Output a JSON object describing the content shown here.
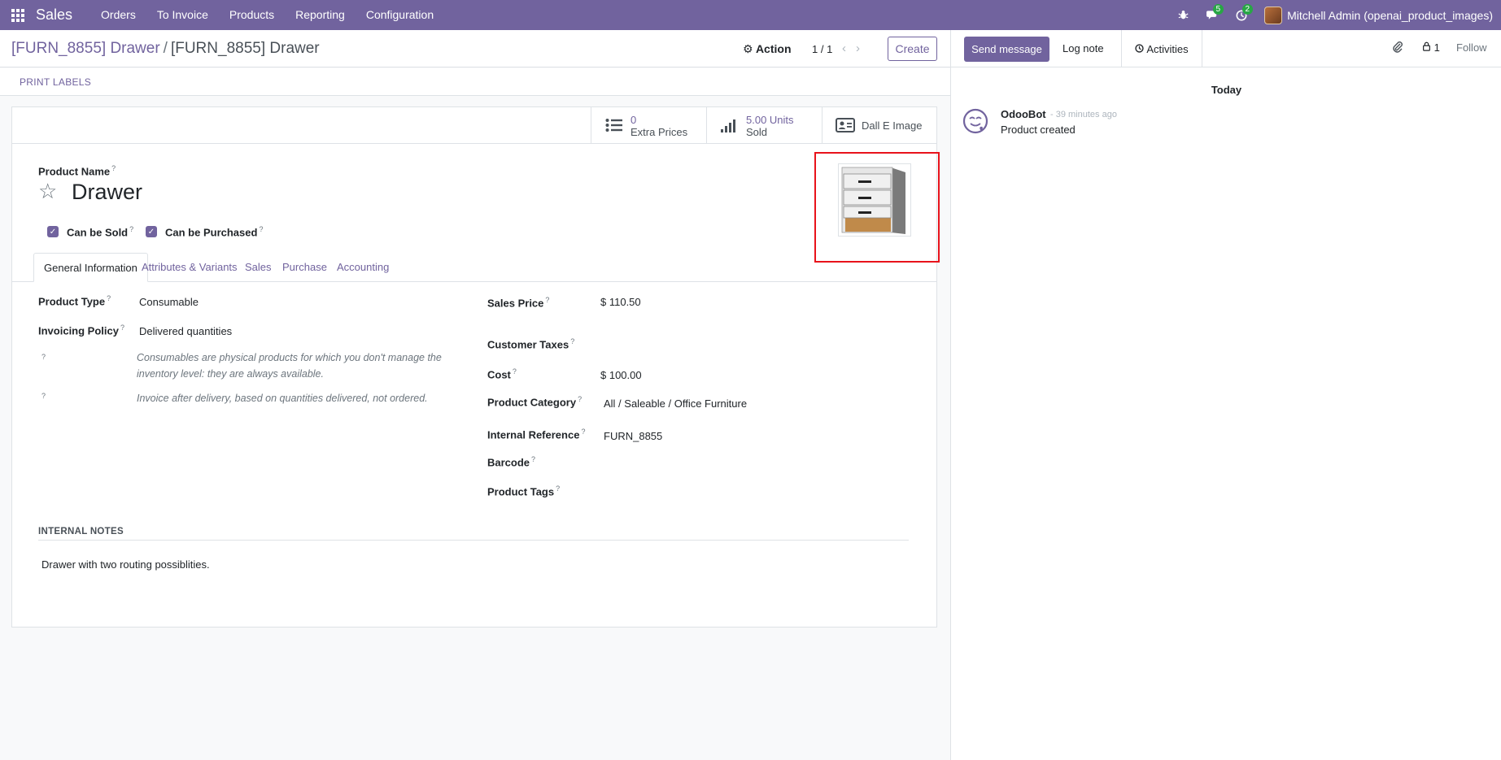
{
  "navbar": {
    "brand": "Sales",
    "menu": [
      "Orders",
      "To Invoice",
      "Products",
      "Reporting",
      "Configuration"
    ],
    "messages_count": "5",
    "activities_count": "2",
    "user": "Mitchell Admin (openai_product_images)"
  },
  "control": {
    "breadcrumb_parent": "[FURN_8855] Drawer",
    "breadcrumb_current": "[FURN_8855] Drawer",
    "action_label": "Action",
    "pager": "1 / 1",
    "create_label": "Create"
  },
  "statusbar": {
    "print_labels": "PRINT LABELS"
  },
  "smart_buttons": {
    "extra_prices_value": "0",
    "extra_prices_label": "Extra Prices",
    "sold_value": "5.00 Units",
    "sold_label": "Sold",
    "dalle_label": "Dall E Image"
  },
  "form": {
    "product_name_label": "Product Name",
    "product_name": "Drawer",
    "can_be_sold": "Can be Sold",
    "can_be_purchased": "Can be Purchased",
    "tabs": [
      "General Information",
      "Attributes & Variants",
      "Sales",
      "Purchase",
      "Accounting"
    ],
    "product_type_label": "Product Type",
    "product_type": "Consumable",
    "invoicing_policy_label": "Invoicing Policy",
    "invoicing_policy": "Delivered quantities",
    "help_consumable": "Consumables are physical products for which you don't manage the inventory level: they are always available.",
    "help_invoice": "Invoice after delivery, based on quantities delivered, not ordered.",
    "sales_price_label": "Sales Price",
    "sales_price": "$ 110.50",
    "customer_taxes_label": "Customer Taxes",
    "cost_label": "Cost",
    "cost": "$ 100.00",
    "product_category_label": "Product Category",
    "product_category": "All / Saleable / Office Furniture",
    "internal_reference_label": "Internal Reference",
    "internal_reference": "FURN_8855",
    "barcode_label": "Barcode",
    "product_tags_label": "Product Tags",
    "internal_notes_title": "INTERNAL NOTES",
    "internal_notes": "Drawer with two routing possiblities."
  },
  "chatter": {
    "send_message": "Send message",
    "log_note": "Log note",
    "activities": "Activities",
    "followers_count": "1",
    "follow": "Follow",
    "today": "Today",
    "author": "OdooBot",
    "time": "- 39 minutes ago",
    "body": "Product created"
  },
  "colors": {
    "brand": "#71639e",
    "highlight": "#e8131b"
  }
}
